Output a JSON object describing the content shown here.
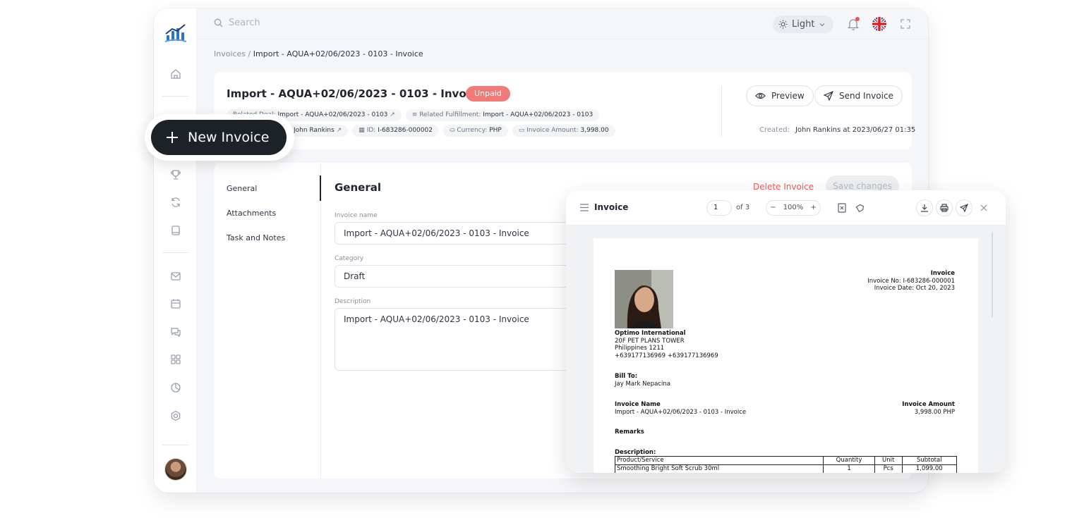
{
  "topbar": {
    "search_placeholder": "Search",
    "theme_label": "Light"
  },
  "breadcrumb": {
    "root": "Invoices",
    "separator": " / ",
    "current": "Import - AQUA+02/06/2023 - 0103 - Invoice"
  },
  "header": {
    "title": "Import - AQUA+02/06/2023 - 0103 - Invoice",
    "status": "Unpaid",
    "related_prefix": "Related Deal:",
    "related_deal": "Import - AQUA+02/06/2023 - 0103",
    "related_fulfillment_label": "Related Fulfillment:",
    "related_fulfillment": "Import - AQUA+02/06/2023 - 0103",
    "owner": "John Rankins",
    "id_label": "ID:",
    "id": "I-683286-000002",
    "currency_label": "Currency:",
    "currency": "PHP",
    "amount_label": "Invoice Amount:",
    "amount": "3,998.00",
    "preview_label": "Preview",
    "send_label": "Send Invoice",
    "created_label": "Created:",
    "created_value": "John Rankins at 2023/06/27 01:35"
  },
  "new_invoice": {
    "label": "New Invoice"
  },
  "tabs": [
    {
      "label": "General"
    },
    {
      "label": "Attachments"
    },
    {
      "label": "Task and Notes"
    }
  ],
  "general": {
    "title": "General",
    "delete_label": "Delete Invoice",
    "save_label": "Save changes",
    "name_label": "Invoice name",
    "name_value": "Import - AQUA+02/06/2023 - 0103 - Invoice",
    "category_label": "Category",
    "category_value": "Draft",
    "description_label": "Description",
    "description_value": "Import - AQUA+02/06/2023 - 0103 - Invoice"
  },
  "viewer": {
    "title": "Invoice",
    "page": "1",
    "of_pages": "of 3",
    "zoom": "100%",
    "zoom_minus": "−",
    "zoom_plus": "+"
  },
  "document": {
    "heading": "Invoice",
    "invoice_no": "Invoice No: I-683286-000001",
    "invoice_date": "Invoice Date: Oct 20, 2023",
    "company": "Optimo International",
    "address1": "20F PET PLANS TOWER",
    "address2": "Philippines 1211",
    "phones": "+639177136969 +639177136969",
    "bill_to_label": "Bill To:",
    "bill_to": "Jay Mark Nepacina",
    "invoice_name_label": "Invoice Name",
    "invoice_name": "Import - AQUA+02/06/2023 - 0103 - Invoice",
    "invoice_amount_label": "Invoice Amount",
    "invoice_amount": "3,998.00 PHP",
    "remarks_label": "Remarks",
    "description_label": "Description:",
    "table_headers": [
      "Product/Service",
      "Quantity",
      "Unit",
      "Subtotal"
    ],
    "rows": [
      [
        "Smoothing Bright Soft Scrub 30ml",
        "1",
        "Pcs",
        "1,099.00"
      ]
    ]
  }
}
